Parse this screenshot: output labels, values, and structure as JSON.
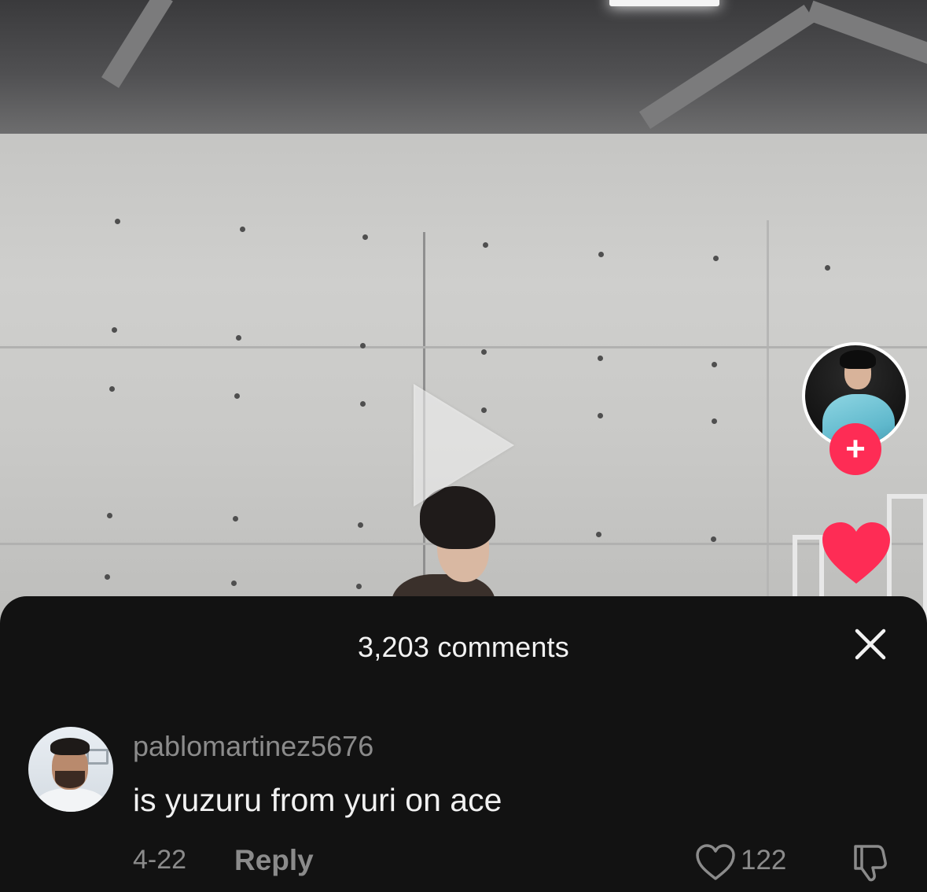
{
  "video": {
    "play_icon": "play-icon",
    "creator_avatar_icon": "avatar",
    "follow_icon": "plus-icon",
    "follow_label": "+",
    "like_icon": "heart-filled-icon",
    "accent_color": "#fe2c55"
  },
  "comments_sheet": {
    "title": "3,203 comments",
    "close_icon": "close-icon"
  },
  "comments": [
    {
      "username": "pablomartinez5676",
      "text": "is yuzuru from yuri on ace",
      "date": "4-22",
      "reply_label": "Reply",
      "like_count": "122",
      "like_icon": "heart-outline-icon",
      "dislike_icon": "thumbs-down-icon"
    }
  ]
}
